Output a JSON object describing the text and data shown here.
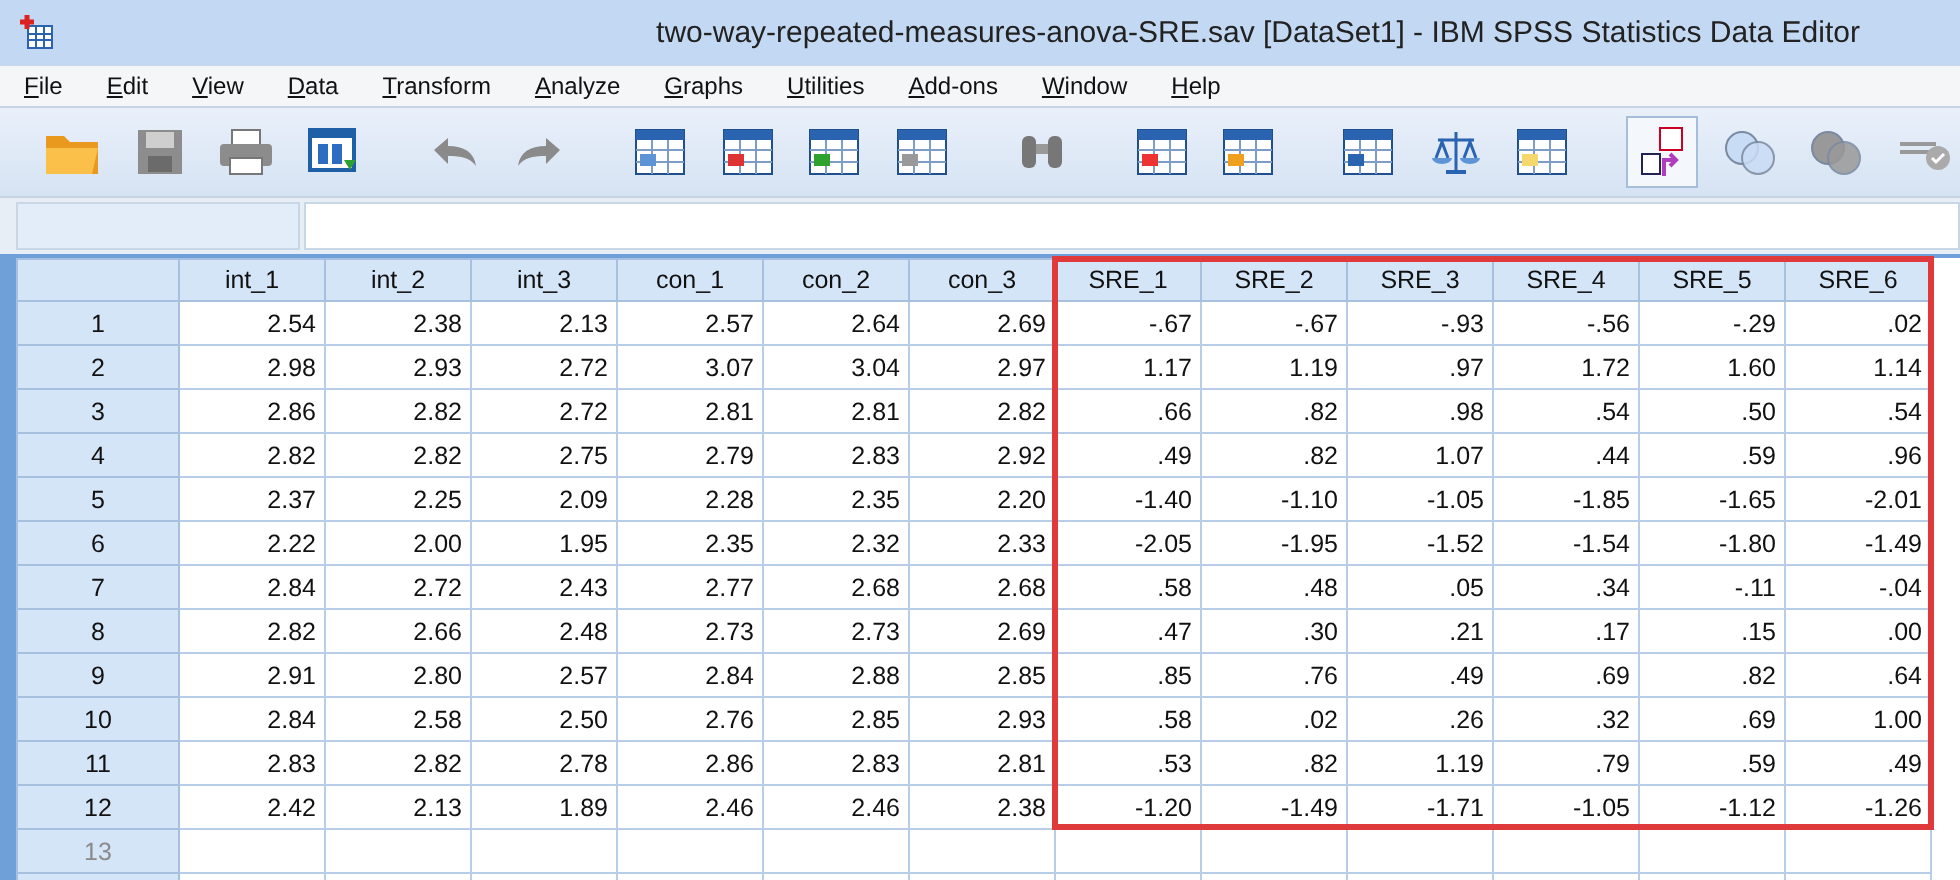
{
  "window": {
    "title": "two-way-repeated-measures-anova-SRE.sav [DataSet1] - IBM SPSS Statistics Data Editor"
  },
  "menu": [
    "File",
    "Edit",
    "View",
    "Data",
    "Transform",
    "Analyze",
    "Graphs",
    "Utilities",
    "Add-ons",
    "Window",
    "Help"
  ],
  "table": {
    "columns": [
      {
        "name": "int_1",
        "highlighted": false
      },
      {
        "name": "int_2",
        "highlighted": false
      },
      {
        "name": "int_3",
        "highlighted": false
      },
      {
        "name": "con_1",
        "highlighted": false
      },
      {
        "name": "con_2",
        "highlighted": false
      },
      {
        "name": "con_3",
        "highlighted": false
      },
      {
        "name": "SRE_1",
        "highlighted": true
      },
      {
        "name": "SRE_2",
        "highlighted": true
      },
      {
        "name": "SRE_3",
        "highlighted": true
      },
      {
        "name": "SRE_4",
        "highlighted": true
      },
      {
        "name": "SRE_5",
        "highlighted": true
      },
      {
        "name": "SRE_6",
        "highlighted": true
      }
    ],
    "rows": [
      {
        "number": "1",
        "cells": [
          "2.54",
          "2.38",
          "2.13",
          "2.57",
          "2.64",
          "2.69",
          "-.67",
          "-.67",
          "-.93",
          "-.56",
          "-.29",
          ".02"
        ]
      },
      {
        "number": "2",
        "cells": [
          "2.98",
          "2.93",
          "2.72",
          "3.07",
          "3.04",
          "2.97",
          "1.17",
          "1.19",
          ".97",
          "1.72",
          "1.60",
          "1.14"
        ]
      },
      {
        "number": "3",
        "cells": [
          "2.86",
          "2.82",
          "2.72",
          "2.81",
          "2.81",
          "2.82",
          ".66",
          ".82",
          ".98",
          ".54",
          ".50",
          ".54"
        ]
      },
      {
        "number": "4",
        "cells": [
          "2.82",
          "2.82",
          "2.75",
          "2.79",
          "2.83",
          "2.92",
          ".49",
          ".82",
          "1.07",
          ".44",
          ".59",
          ".96"
        ]
      },
      {
        "number": "5",
        "cells": [
          "2.37",
          "2.25",
          "2.09",
          "2.28",
          "2.35",
          "2.20",
          "-1.40",
          "-1.10",
          "-1.05",
          "-1.85",
          "-1.65",
          "-2.01"
        ]
      },
      {
        "number": "6",
        "cells": [
          "2.22",
          "2.00",
          "1.95",
          "2.35",
          "2.32",
          "2.33",
          "-2.05",
          "-1.95",
          "-1.52",
          "-1.54",
          "-1.80",
          "-1.49"
        ]
      },
      {
        "number": "7",
        "cells": [
          "2.84",
          "2.72",
          "2.43",
          "2.77",
          "2.68",
          "2.68",
          ".58",
          ".48",
          ".05",
          ".34",
          "-.11",
          "-.04"
        ]
      },
      {
        "number": "8",
        "cells": [
          "2.82",
          "2.66",
          "2.48",
          "2.73",
          "2.73",
          "2.69",
          ".47",
          ".30",
          ".21",
          ".17",
          ".15",
          ".00"
        ]
      },
      {
        "number": "9",
        "cells": [
          "2.91",
          "2.80",
          "2.57",
          "2.84",
          "2.88",
          "2.85",
          ".85",
          ".76",
          ".49",
          ".69",
          ".82",
          ".64"
        ]
      },
      {
        "number": "10",
        "cells": [
          "2.84",
          "2.58",
          "2.50",
          "2.76",
          "2.85",
          "2.93",
          ".58",
          ".02",
          ".26",
          ".32",
          ".69",
          "1.00"
        ]
      },
      {
        "number": "11",
        "cells": [
          "2.83",
          "2.82",
          "2.78",
          "2.86",
          "2.83",
          "2.81",
          ".53",
          ".82",
          "1.19",
          ".79",
          ".59",
          ".49"
        ]
      },
      {
        "number": "12",
        "cells": [
          "2.42",
          "2.13",
          "1.89",
          "2.46",
          "2.46",
          "2.38",
          "-1.20",
          "-1.49",
          "-1.71",
          "-1.05",
          "-1.12",
          "-1.26"
        ]
      }
    ],
    "empty_rows": [
      "13"
    ]
  }
}
